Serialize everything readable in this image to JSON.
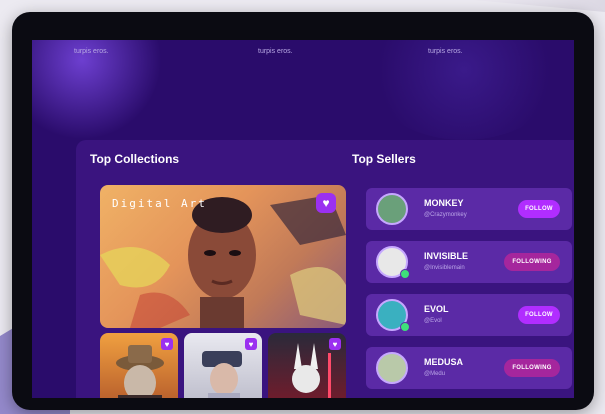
{
  "top_texts": [
    "turpis eros.",
    "turpis eros.",
    "turpis eros."
  ],
  "collections": {
    "title": "Top Collections",
    "feature_label": "Digital Art",
    "heart_icon": "heart-icon"
  },
  "sellers": {
    "title": "Top Sellers",
    "items": [
      {
        "name": "MONKEY",
        "handle": "@Crazymonkey",
        "action": "FOLLOW",
        "online": false
      },
      {
        "name": "INVISIBLE",
        "handle": "@Invisiblemain",
        "action": "FOLLOWING",
        "online": true
      },
      {
        "name": "EVOL",
        "handle": "@Evol",
        "action": "FOLLOW",
        "online": true
      },
      {
        "name": "MEDUSA",
        "handle": "@Medu",
        "action": "FOLLOWING",
        "online": false
      }
    ]
  },
  "colors": {
    "screen_bg": "#2a0c6b",
    "panel_bg": "#3a147f",
    "card_bg": "#5b2aa6",
    "follow": "#b12dff",
    "following": "#a5269d",
    "heart_badge": "#9b30f0"
  }
}
